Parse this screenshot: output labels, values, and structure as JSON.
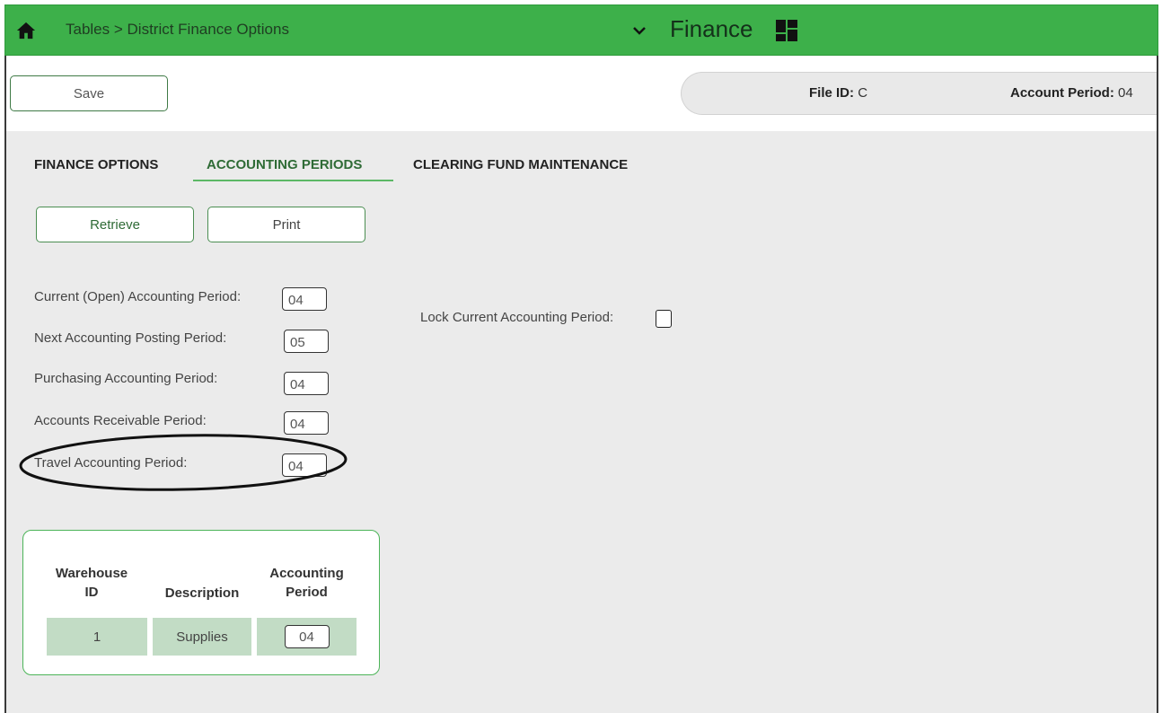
{
  "header": {
    "breadcrumb": "Tables > District Finance Options",
    "module": "Finance",
    "background_color": "#3db04a",
    "home_icon": "home-icon",
    "module_menu_icon": "chevron-down-icon",
    "apps_icon": "grid-icon"
  },
  "toolbar": {
    "save_label": "Save",
    "file_id_label": "File ID:",
    "file_id_value": "C",
    "account_period_label": "Account Period:",
    "account_period_value": "04"
  },
  "tabs": [
    {
      "label": "FINANCE OPTIONS",
      "active": false
    },
    {
      "label": "ACCOUNTING PERIODS",
      "active": true
    },
    {
      "label": "CLEARING FUND MAINTENANCE",
      "active": false
    }
  ],
  "actions": {
    "retrieve_label": "Retrieve",
    "print_label": "Print"
  },
  "fields": {
    "current": {
      "label": "Current (Open) Accounting Period:",
      "value": "04"
    },
    "next": {
      "label": "Next Accounting Posting Period:",
      "value": "05"
    },
    "purchasing": {
      "label": "Purchasing Accounting Period:",
      "value": "04"
    },
    "receivable": {
      "label": "Accounts Receivable Period:",
      "value": "04"
    },
    "travel": {
      "label": "Travel Accounting Period:",
      "value": "04",
      "highlighted": true
    },
    "lock": {
      "label": "Lock Current Accounting Period:",
      "checked": false
    }
  },
  "warehouse_table": {
    "headers": {
      "id_line1": "Warehouse",
      "id_line2": "ID",
      "description": "Description",
      "period_line1": "Accounting",
      "period_line2": "Period"
    },
    "rows": [
      {
        "id": "1",
        "description": "Supplies",
        "period": "04"
      }
    ]
  },
  "colors": {
    "accent": "#3db04a",
    "row_fill": "#c2dcc5",
    "content_bg": "#ebebeb"
  }
}
